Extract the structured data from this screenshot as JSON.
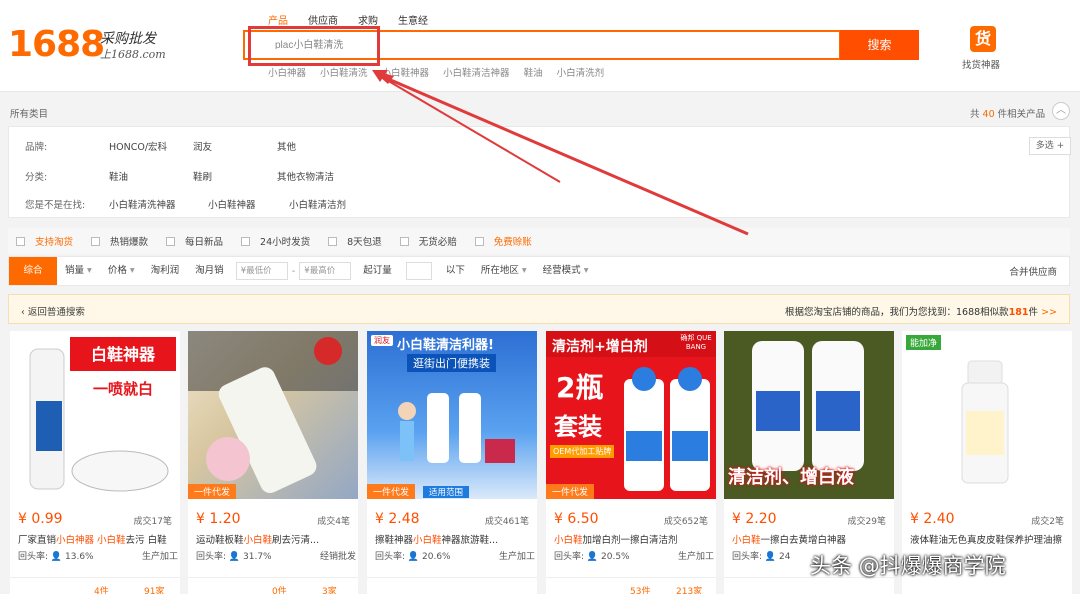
{
  "header": {
    "logo": "1688",
    "logo_sub1": "采购批发",
    "logo_sub2": "上1688.com",
    "search_tabs": [
      {
        "label": "产品",
        "active": true
      },
      {
        "label": "供应商",
        "active": false
      },
      {
        "label": "求购",
        "active": false
      },
      {
        "label": "生意经",
        "active": false
      }
    ],
    "search_value": "plac小白鞋清洗",
    "search_button": "搜索",
    "hot_terms": [
      "小白神器",
      "小白鞋清洗",
      "小白鞋神器",
      "小白鞋清洁神器",
      "鞋油",
      "小白清洗剂"
    ],
    "finder_icon": "货",
    "finder_label": "找货神器"
  },
  "filters": {
    "breadcrumb": "所有类目",
    "count_prefix": "共",
    "count_value": "40",
    "count_suffix": "件相关产品",
    "multi_select": "多选 +",
    "rows": [
      {
        "label": "品牌:",
        "values": [
          "HONCO/宏科",
          "润友",
          "其他"
        ]
      },
      {
        "label": "分类:",
        "values": [
          "鞋油",
          "鞋刷",
          "其他衣物清洁"
        ]
      },
      {
        "label": "您是不是在找:",
        "values": [
          "小白鞋清洗神器",
          "小白鞋神器",
          "小白鞋清洁剂"
        ]
      }
    ],
    "checkboxes": [
      {
        "label": "支持淘货",
        "orange": true
      },
      {
        "label": "热销爆款",
        "orange": false
      },
      {
        "label": "每日新品",
        "orange": false
      },
      {
        "label": "24小时发货",
        "orange": false
      },
      {
        "label": "8天包退",
        "orange": false
      },
      {
        "label": "无货必赔",
        "orange": false
      },
      {
        "label": "免费赊账",
        "orange": true
      }
    ]
  },
  "sortbar": {
    "items": [
      "综合",
      "销量",
      "价格",
      "淘利润",
      "淘月销"
    ],
    "min_price": "¥最低价",
    "max_price": "¥最高价",
    "moq_label": "起订量",
    "moq_suffix": "以下",
    "region": "所在地区",
    "mode": "经营模式",
    "merge": "合并供应商"
  },
  "notice": {
    "back": "返回普通搜索",
    "text_prefix": "根据您淘宝店铺的商品，我们为您找到：1688相似款",
    "text_count": "181",
    "text_suffix": "件",
    "more": ">>"
  },
  "products": [
    {
      "price": "¥ 0.99",
      "sold": "成交17笔",
      "title_a": "厂家直销",
      "title_hl": "小白神器 小白鞋",
      "title_b": "去污 白鞋",
      "rate_label": "回头率:",
      "rate": "13.6%",
      "biz": "生产加工",
      "stat_a": "4件",
      "stat_b": "91家",
      "tag": "",
      "img_text": "白鞋神器",
      "img_text2": "一喷就白"
    },
    {
      "price": "¥ 1.20",
      "sold": "成交4笔",
      "title_a": "运动鞋板鞋",
      "title_hl": "小白鞋",
      "title_b": "刷去污清...",
      "rate_label": "回头率:",
      "rate": "31.7%",
      "biz": "经销批发",
      "stat_a": "0件",
      "stat_b": "3家",
      "tag": "一件代发",
      "img_text": "",
      "img_text2": ""
    },
    {
      "price": "¥ 2.48",
      "sold": "成交461笔",
      "title_a": "擦鞋神器",
      "title_hl": "小白鞋",
      "title_b": "神器旅游鞋...",
      "rate_label": "回头率:",
      "rate": "20.6%",
      "biz": "生产加工",
      "stat_a": "",
      "stat_b": "",
      "tag": "一件代发",
      "img_text": "小白鞋清洁利器!",
      "img_text2": "逛街出门便携装",
      "img_text3": "适用范围"
    },
    {
      "price": "¥ 6.50",
      "sold": "成交652笔",
      "title_a": "",
      "title_hl": "小白鞋",
      "title_b": "加增白剂一擦白清洁剂",
      "rate_label": "回头率:",
      "rate": "20.5%",
      "biz": "生产加工",
      "stat_a": "53件",
      "stat_b": "213家",
      "tag": "一件代发",
      "img_text": "清洁剂+增白剂",
      "img_text2": "2瓶",
      "img_text3": "套装",
      "img_text4": "OEM代加工贴牌",
      "img_brand": "确邦 QUE BANG"
    },
    {
      "price": "¥ 2.20",
      "sold": "成交29笔",
      "title_a": "",
      "title_hl": "小白鞋",
      "title_b": "一擦白去黄增白神器",
      "rate_label": "回头率:",
      "rate": "24",
      "biz": "",
      "stat_a": "",
      "stat_b": "",
      "tag": "",
      "img_text": "清洁剂、增白液",
      "img_text2": ""
    },
    {
      "price": "¥ 2.40",
      "sold": "成交2笔",
      "title_a": "液体鞋油无色真皮皮鞋保养护理油擦",
      "title_hl": "",
      "title_b": "",
      "rate_label": "",
      "rate": "",
      "biz": "",
      "stat_a": "",
      "stat_b": "",
      "tag": "",
      "img_text": "",
      "img_text2": "",
      "img_brand": "能加净"
    }
  ],
  "watermark": "头条 @抖爆爆商学院",
  "colors": {
    "brand": "#ff6a00",
    "search_button": "#ff4e00",
    "annotation": "#e03a3a"
  }
}
